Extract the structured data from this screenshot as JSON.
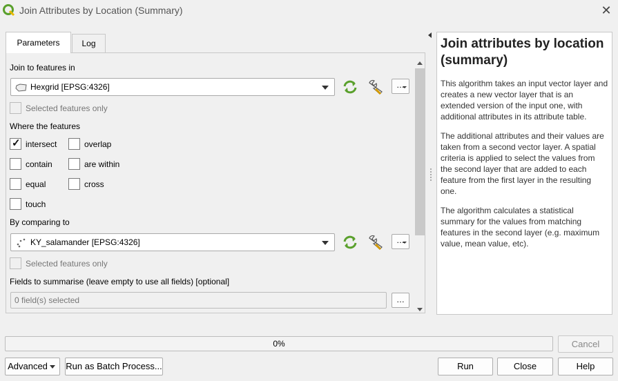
{
  "window": {
    "title": "Join Attributes by Location (Summary)"
  },
  "tabs": [
    {
      "label": "Parameters",
      "active": true
    },
    {
      "label": "Log",
      "active": false
    }
  ],
  "params": {
    "join_label": "Join to features in",
    "join_layer": "Hexgrid [EPSG:4326]",
    "join_selected_only": "Selected features only",
    "where_label": "Where the features",
    "predicates": [
      {
        "label": "intersect",
        "checked": true
      },
      {
        "label": "overlap",
        "checked": false
      },
      {
        "label": "contain",
        "checked": false
      },
      {
        "label": "are within",
        "checked": false
      },
      {
        "label": "equal",
        "checked": false
      },
      {
        "label": "cross",
        "checked": false
      },
      {
        "label": "touch",
        "checked": false
      }
    ],
    "compare_label": "By comparing to",
    "compare_layer": "KY_salamander [EPSG:4326]",
    "compare_selected_only": "Selected features only",
    "fields_label": "Fields to summarise (leave empty to use all fields) [optional]",
    "fields_value": "0 field(s) selected",
    "dots": "…"
  },
  "help": {
    "title": "Join attributes by location (summary)",
    "paragraphs": [
      "This algorithm takes an input vector layer and creates a new vector layer that is an extended version of the input one, with additional attributes in its attribute table.",
      "The additional attributes and their values are taken from a second vector layer. A spatial criteria is applied to select the values from the second layer that are added to each feature from the first layer in the resulting one.",
      "The algorithm calculates a statistical summary for the values from matching features in the second layer (e.g. maximum value, mean value, etc)."
    ]
  },
  "progress": {
    "percent": 0,
    "text": "0%"
  },
  "buttons": {
    "cancel": "Cancel",
    "advanced": "Advanced",
    "batch": "Run as Batch Process...",
    "run": "Run",
    "close": "Close",
    "help": "Help"
  },
  "colors": {
    "accent_green": "#5aa02c",
    "panel_bg": "#f0f0f0"
  }
}
